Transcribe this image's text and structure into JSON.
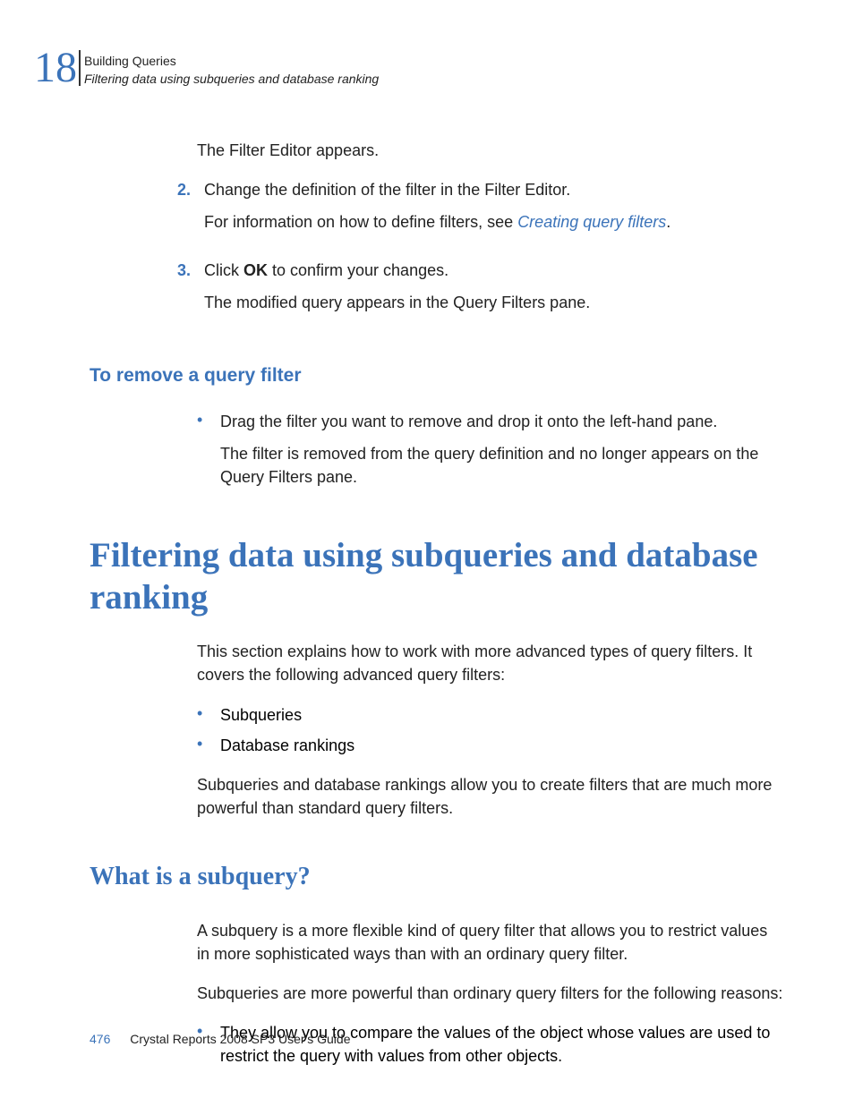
{
  "header": {
    "chapter_number": "18",
    "line1": "Building Queries",
    "line2": "Filtering data using subqueries and database ranking"
  },
  "intro_continuation": "The Filter Editor appears.",
  "steps": [
    {
      "num": "2.",
      "text": "Change the definition of the filter in the Filter Editor.",
      "note_prefix": "For information on how to define filters, see ",
      "note_link": "Creating query filters",
      "note_suffix": "."
    },
    {
      "num": "3.",
      "text_prefix": "Click ",
      "text_bold": "OK",
      "text_suffix": " to confirm your changes.",
      "result": "The modified query appears in the Query Filters pane."
    }
  ],
  "remove_filter": {
    "heading": "To remove a query filter",
    "bullet_text": "Drag the filter you want to remove and drop it onto the left-hand pane.",
    "bullet_result": "The filter is removed from the query definition and no longer appears on the Query Filters pane."
  },
  "main_heading": "Filtering data using subqueries and database ranking",
  "main_intro": "This section explains how to work with more advanced types of query filters. It covers the following advanced query filters:",
  "main_bullets": [
    "Subqueries",
    "Database rankings"
  ],
  "main_outro": "Subqueries and database rankings allow you to create filters that are much more powerful than standard query filters.",
  "subquery": {
    "heading": "What is a subquery?",
    "para1": "A subquery is a more flexible kind of query filter that allows you to restrict values in more sophisticated ways than with an ordinary query filter.",
    "para2": "Subqueries are more powerful than ordinary query filters for the following reasons:",
    "bullet1": "They allow you to compare the values of the object whose values are used to restrict the query with values from other objects."
  },
  "footer": {
    "page": "476",
    "text": "Crystal Reports 2008 SP3 User's Guide"
  }
}
